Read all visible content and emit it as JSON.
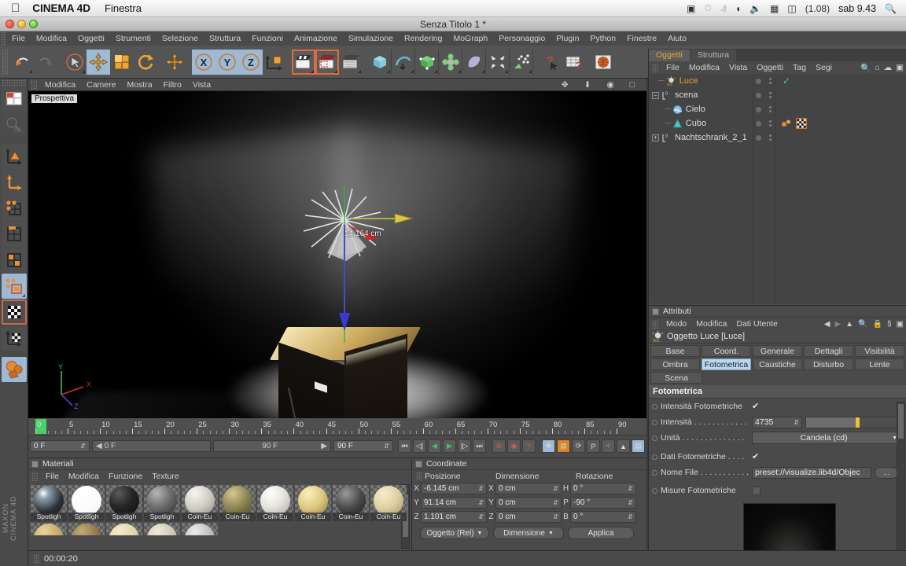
{
  "macbar": {
    "apple_icon": "apple-icon",
    "app_name": "CINEMA 4D",
    "menu": [
      "Finestra"
    ],
    "status_icons": [
      "screen-record-icon",
      "time-machine-icon",
      "bluetooth-icon",
      "wifi-icon",
      "volume-icon",
      "calculator-icon",
      "battery-icon"
    ],
    "battery": "(1.08)",
    "clock": "sab 9.43",
    "search_icon": "spotlight-search-icon"
  },
  "window": {
    "title": "Senza Titolo 1 *"
  },
  "menubar": {
    "items": [
      "File",
      "Modifica",
      "Oggetti",
      "Strumenti",
      "Selezione",
      "Struttura",
      "Funzioni",
      "Animazione",
      "Simulazione",
      "Rendering",
      "MoGraph",
      "Personaggio",
      "Plugin",
      "Python",
      "Finestre",
      "Aiuto"
    ]
  },
  "toolbar": {
    "groups": [
      {
        "buttons": [
          {
            "name": "undo-icon",
            "label": "↺",
            "state": "normal"
          },
          {
            "name": "redo-icon",
            "label": "↻",
            "state": "disabled"
          }
        ]
      },
      {
        "buttons": [
          {
            "name": "select-live-icon",
            "label": "➤",
            "state": "normal"
          },
          {
            "name": "move-tool-icon",
            "label": "✥",
            "state": "selected"
          },
          {
            "name": "scale-tool-icon",
            "label": "▧",
            "state": "normal"
          },
          {
            "name": "rotate-tool-icon",
            "label": "⟳",
            "state": "normal"
          }
        ]
      },
      {
        "buttons": [
          {
            "name": "move-axis-icon",
            "label": "✥",
            "state": "normal"
          }
        ]
      },
      {
        "buttons": [
          {
            "name": "lock-x-axis-icon",
            "label": "X",
            "state": "selected"
          },
          {
            "name": "lock-y-axis-icon",
            "label": "Y",
            "state": "selected"
          },
          {
            "name": "lock-z-axis-icon",
            "label": "Z",
            "state": "selected"
          },
          {
            "name": "world-object-coord-icon",
            "label": "⬚",
            "state": "normal"
          }
        ]
      },
      {
        "buttons": [
          {
            "name": "render-view-icon",
            "label": "🎬",
            "state": "recording"
          },
          {
            "name": "render-region-icon",
            "label": "🎬",
            "state": "recording"
          },
          {
            "name": "render-settings-icon",
            "label": "🎬",
            "state": "normal"
          }
        ]
      },
      {
        "buttons": [
          {
            "name": "cube-primitive-icon",
            "label": "▣",
            "state": "normal"
          },
          {
            "name": "spline-pen-icon",
            "label": "∿",
            "state": "normal"
          },
          {
            "name": "generator-icon",
            "label": "◈",
            "state": "normal"
          },
          {
            "name": "mograph-cloner-icon",
            "label": "❋",
            "state": "normal"
          },
          {
            "name": "deformer-icon",
            "label": "◗",
            "state": "normal"
          },
          {
            "name": "environment-icon",
            "label": "✧",
            "state": "normal"
          },
          {
            "name": "particles-icon",
            "label": "⁘",
            "state": "normal"
          }
        ]
      },
      {
        "buttons": [
          {
            "name": "help-cursor-icon",
            "label": "?",
            "state": "normal"
          },
          {
            "name": "help-table-icon",
            "label": "⊞",
            "state": "normal"
          }
        ]
      },
      {
        "buttons": [
          {
            "name": "content-browser-icon",
            "label": "◉",
            "state": "normal"
          }
        ]
      }
    ]
  },
  "left_tools": [
    {
      "name": "layout-manager-icon",
      "label": "▦",
      "state": "normal"
    },
    {
      "name": "undo-view-icon",
      "label": "◎",
      "state": "disabled"
    },
    {
      "name": "model-mode-icon",
      "label": "△",
      "state": "normal"
    },
    {
      "name": "object-axis-icon",
      "label": "⌐",
      "state": "normal"
    },
    {
      "name": "points-mode-icon",
      "label": "⁘",
      "state": "normal"
    },
    {
      "name": "edges-mode-icon",
      "label": "⊞",
      "state": "normal"
    },
    {
      "name": "polygons-mode-icon",
      "label": "▥",
      "state": "normal"
    },
    {
      "name": "enable-axis-icon",
      "label": "⊡",
      "state": "selected"
    },
    {
      "name": "texture-mode-icon",
      "label": "▨",
      "state": "recording"
    },
    {
      "name": "texture-axis-icon",
      "label": "▩",
      "state": "normal"
    },
    {
      "name": "viewport-solo-icon",
      "label": "◍",
      "state": "selected"
    }
  ],
  "maxon_brand": "MAXON CINEMA 4D",
  "viewport": {
    "menu": [
      "Modifica",
      "Camere",
      "Mostra",
      "Filtro",
      "Vista"
    ],
    "nav_icons": [
      "pan-view-icon",
      "dolly-view-icon",
      "rotate-view-icon",
      "maximize-view-icon"
    ],
    "label": "Prospettiva",
    "measurement": "14.164 cm",
    "axis_labels": {
      "y": "Y",
      "x": "X",
      "z": "Z"
    }
  },
  "timeline": {
    "ruler_ticks": [
      "0",
      "5",
      "10",
      "15",
      "20",
      "25",
      "30",
      "35",
      "40",
      "45",
      "50",
      "55",
      "60",
      "65",
      "70",
      "75",
      "80",
      "85",
      "90"
    ],
    "current_frame_field": "0 F",
    "range_start": "0 F",
    "range_end": "90 F",
    "preview_start": "0 F",
    "preview_end_left": "90 F",
    "preview_end_right": "90 F",
    "transport": [
      {
        "name": "go-to-start-button",
        "label": "⏮"
      },
      {
        "name": "step-back-button",
        "label": "◁|"
      },
      {
        "name": "play-reverse-button",
        "label": "◀"
      },
      {
        "name": "play-forward-button",
        "label": "▶"
      },
      {
        "name": "step-forward-button",
        "label": "|▷"
      },
      {
        "name": "go-to-end-button",
        "label": "⏭"
      }
    ],
    "record_buttons": [
      {
        "name": "record-keyframe-button",
        "label": "⊘"
      },
      {
        "name": "autokey-button",
        "label": "◉"
      },
      {
        "name": "keyframe-selection-button",
        "label": "?"
      }
    ],
    "key_toggles": [
      {
        "name": "record-position-button",
        "label": "✥"
      },
      {
        "name": "record-scale-button",
        "label": "▤"
      },
      {
        "name": "record-rotation-button",
        "label": "⟳"
      },
      {
        "name": "record-parameter-button",
        "label": "P"
      },
      {
        "name": "record-pla-button",
        "label": "⁘"
      },
      {
        "name": "keyframe-mode-button",
        "label": "▲"
      },
      {
        "name": "animation-layers-button",
        "label": "▤"
      }
    ]
  },
  "materials": {
    "title": "Materiali",
    "menu": [
      "File",
      "Modifica",
      "Funzione",
      "Texture"
    ],
    "items": [
      {
        "label": "Spotligh",
        "color": "#3d4248",
        "type": "metal"
      },
      {
        "label": "Spotligh",
        "color": "#ffffff",
        "type": "white"
      },
      {
        "label": "Spotligh",
        "color": "#232323",
        "type": "dark"
      },
      {
        "label": "Spotligh",
        "color": "#4e4e4e",
        "type": "gray"
      },
      {
        "label": "Coin-Eu",
        "color": "#cfcdc4",
        "type": "stone"
      },
      {
        "label": "Coin-Eu",
        "color": "#8c8452",
        "type": "bronze"
      },
      {
        "label": "Coin-Eu",
        "color": "#e6e4dd",
        "type": "marble"
      },
      {
        "label": "Coin-Eu",
        "color": "#ddc77f",
        "type": "gold"
      },
      {
        "label": "Coin-Eu",
        "color": "#4a4a4a",
        "type": "iron"
      },
      {
        "label": "Coin-Eu",
        "color": "#ddd0a0",
        "type": "sand"
      }
    ],
    "items_row2": [
      {
        "label": "",
        "color": "#c0a368",
        "type": "gold2"
      },
      {
        "label": "",
        "color": "#8e7249",
        "type": "bronze2"
      },
      {
        "label": "",
        "color": "#ddd3a8",
        "type": "sand2"
      },
      {
        "label": "",
        "color": "#ccc6ae",
        "type": "stone2"
      },
      {
        "label": "",
        "color": "#b9bcb9",
        "type": "silver2"
      }
    ]
  },
  "coordinates": {
    "title": "Coordinate",
    "col_headers": [
      "Posizione",
      "Dimensione",
      "Rotazione"
    ],
    "position": {
      "labels": [
        "X",
        "Y",
        "Z"
      ],
      "values": [
        "-6.145 cm",
        "91.14 cm",
        "1.101 cm"
      ]
    },
    "size": {
      "labels": [
        "X",
        "Y",
        "Z"
      ],
      "values": [
        "0 cm",
        "0 cm",
        "0 cm"
      ]
    },
    "rotation": {
      "labels": [
        "H",
        "P",
        "B"
      ],
      "values": [
        "0 °",
        "-90 °",
        "0 °"
      ]
    },
    "mode_dropdown": "Oggetto (Rel)",
    "size_dropdown": "Dimensione",
    "apply_button": "Applica"
  },
  "object_manager": {
    "tabs": [
      {
        "label": "Oggetti",
        "active": true
      },
      {
        "label": "Struttura",
        "active": false
      }
    ],
    "menu": [
      "File",
      "Modifica",
      "Vista",
      "Oggetti",
      "Tag",
      "Segi"
    ],
    "header_icons": [
      "search-icon",
      "home-icon",
      "cloud-icon",
      "fit-icon"
    ],
    "tree": [
      {
        "name": "Luce",
        "icon": "ies-light-icon",
        "indent": 1,
        "expander": false,
        "highlight": true,
        "visible_check": true,
        "tags": []
      },
      {
        "name": "scena",
        "icon": "null-object-icon",
        "indent": 0,
        "expander": "-",
        "highlight": false,
        "visible_check": false,
        "tags": []
      },
      {
        "name": "Cielo",
        "icon": "sky-object-icon",
        "indent": 1,
        "expander": false,
        "highlight": false,
        "visible_check": false,
        "tags": []
      },
      {
        "name": "Cubo",
        "icon": "cone-object-icon",
        "indent": 1,
        "expander": false,
        "highlight": false,
        "visible_check": false,
        "tags": [
          "material-tag",
          "checker-texture-tag"
        ]
      },
      {
        "name": "Nachtschrank_2_1",
        "icon": "null-object-icon",
        "indent": 0,
        "expander": "+",
        "highlight": false,
        "visible_check": false,
        "tags": []
      }
    ]
  },
  "attributes": {
    "title": "Attributi",
    "menu": [
      "Modo",
      "Modifica",
      "Dati Utente"
    ],
    "header_icons": [
      "back-arrow-icon",
      "forward-arrow-icon",
      "up-arrow-icon",
      "search-icon",
      "lock-icon",
      "pin-icon",
      "fit-icon"
    ],
    "object_title": "Oggetto Luce [Luce]",
    "object_icon": "ies-light-icon",
    "tabs_row1": [
      "Base",
      "Coord.",
      "Generale",
      "Dettagli",
      "Visibilità"
    ],
    "tabs_row2": [
      "Ombra",
      "Fotometrica",
      "Caustiche",
      "Disturbo",
      "Lente"
    ],
    "tabs_row3": [
      "Scena"
    ],
    "active_tab": "Fotometrica",
    "section_title": "Fotometrica",
    "fields": [
      {
        "name": "photometric-intensity-checkbox",
        "label": "Intensità Fotometriche",
        "type": "checkbox",
        "value": "✔"
      },
      {
        "name": "intensity-field",
        "label": "Intensità . . . . . . . . . . . .",
        "type": "number-slider",
        "value": "4735",
        "slider_pct": 53
      },
      {
        "name": "unit-dropdown",
        "label": "Unità . . . . . . . . . . . . . .",
        "type": "dropdown",
        "value": "Candela (cd)"
      },
      {
        "name": "photometric-data-checkbox",
        "label": "Dati Fotometriche . . . .",
        "type": "checkbox",
        "value": "✔"
      },
      {
        "name": "filename-field",
        "label": "Nome File . . . . . . . . . . .",
        "type": "text-button",
        "value": "preset://visualize.lib4d/Objec",
        "button": "..."
      },
      {
        "name": "photometric-measures-checkbox",
        "label": "Misure Fotometriche",
        "type": "checkbox-empty",
        "value": ""
      }
    ]
  },
  "status": {
    "time": "00:00:20"
  },
  "colors": {
    "accent_orange": "#e4a13c",
    "selection_blue": "#9db9d6",
    "panel_bg": "#4a4a4a",
    "record_red": "#e06a3a",
    "green_marker": "#46d46a"
  }
}
